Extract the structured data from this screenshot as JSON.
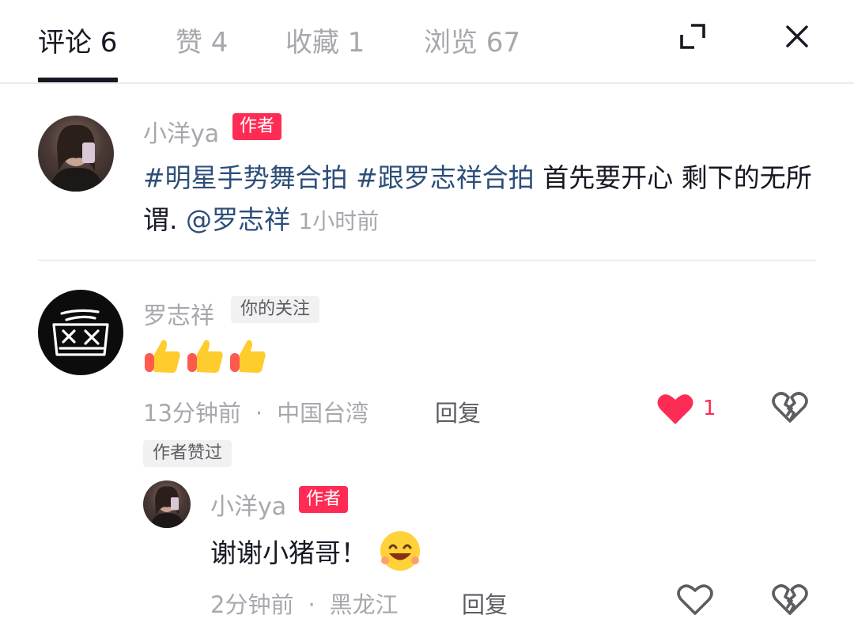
{
  "tabs": [
    {
      "label": "评论 6"
    },
    {
      "label": "赞 4"
    },
    {
      "label": "收藏 1"
    },
    {
      "label": "浏览 67"
    }
  ],
  "header_icons": {
    "expand": "expand-icon",
    "close": "close-icon"
  },
  "post": {
    "author_name": "小洋ya",
    "author_tag": "作者",
    "hashtag1": "#明星手势舞合拍",
    "hashtag2": "#跟罗志祥合拍",
    "text_mid": " 首先要开心 剩下的无所谓. ",
    "mention": "@罗志祥",
    "time": "1小时前"
  },
  "comment": {
    "author_name": "罗志祥",
    "follow_tag": "你的关注",
    "emoji": [
      "thumbs-up",
      "thumbs-up",
      "thumbs-up"
    ],
    "time": "13分钟前",
    "separator": "·",
    "location": "中国台湾",
    "reply_label": "回复",
    "like_count": "1",
    "liked": true,
    "author_liked_tag": "作者赞过"
  },
  "reply": {
    "author_name": "小洋ya",
    "author_tag": "作者",
    "text": "谢谢小猪哥！",
    "emoji": "grinning-face",
    "time": "2分钟前",
    "separator": "·",
    "location": "黑龙江",
    "reply_label": "回复"
  },
  "colors": {
    "accent_red": "#fe2c55",
    "link_blue": "#2d4e79",
    "text_primary": "#161823",
    "text_secondary": "#a7a8ad"
  }
}
